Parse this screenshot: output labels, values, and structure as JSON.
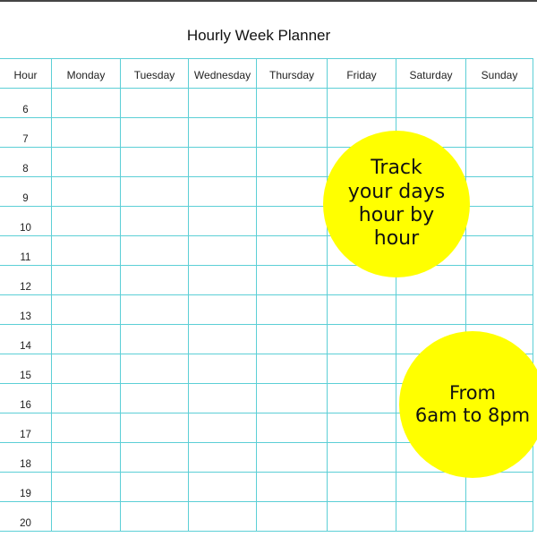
{
  "title": "Hourly Week Planner",
  "table": {
    "headers": [
      "Hour",
      "Monday",
      "Tuesday",
      "Wednesday",
      "Thursday",
      "Friday",
      "Saturday",
      "Sunday"
    ],
    "hours": [
      "6",
      "7",
      "8",
      "9",
      "10",
      "11",
      "12",
      "13",
      "14",
      "15",
      "16",
      "17",
      "18",
      "19",
      "20"
    ]
  },
  "callouts": [
    {
      "text": "Track\nyour days\nhour by\nhour",
      "color": "#ffff00"
    },
    {
      "text": "From\n6am to 8pm",
      "color": "#ffff00"
    }
  ],
  "colors": {
    "grid": "#5ccfd6",
    "callout": "#ffff00"
  }
}
